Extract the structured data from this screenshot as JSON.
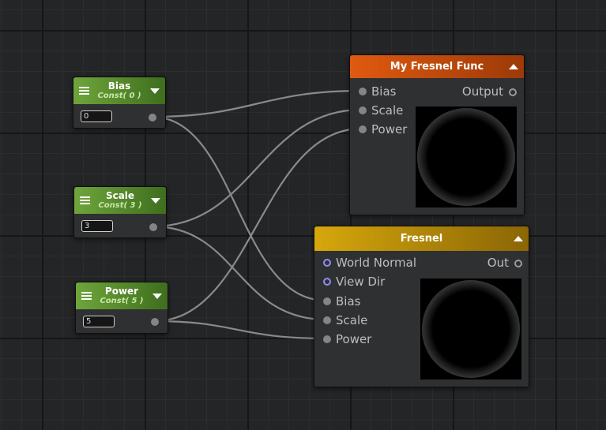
{
  "const_nodes": {
    "bias": {
      "title": "Bias",
      "subtitle": "Const( 0 )",
      "value": "0"
    },
    "scale": {
      "title": "Scale",
      "subtitle": "Const( 3 )",
      "value": "3"
    },
    "power": {
      "title": "Power",
      "subtitle": "Const( 5 )",
      "value": "5"
    }
  },
  "my_fresnel_func": {
    "title": "My Fresnel Func",
    "header_color": "#d14f0c",
    "inputs": [
      "Bias",
      "Scale",
      "Power"
    ],
    "output": "Output"
  },
  "fresnel": {
    "title": "Fresnel",
    "header_color": "#c99a0b",
    "inputs": [
      "World Normal",
      "View Dir",
      "Bias",
      "Scale",
      "Power"
    ],
    "output": "Out"
  },
  "colors": {
    "const_header": "#5e9630",
    "wire": "#8a8a8a",
    "vector_port": "#8e8ef2"
  }
}
